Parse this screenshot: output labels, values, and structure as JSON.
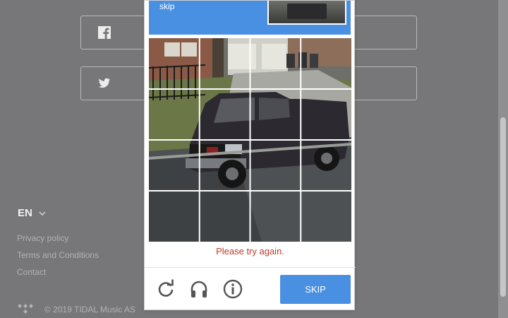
{
  "background": {
    "social": [
      {
        "name": "facebook",
        "icon": "facebook-icon"
      },
      {
        "name": "twitter",
        "icon": "twitter-icon"
      }
    ],
    "language": "EN",
    "footer_links": [
      "Privacy policy",
      "Terms and Conditions",
      "Contact"
    ],
    "copyright": "© 2019 TIDAL Music AS"
  },
  "captcha": {
    "header_text": "skip",
    "error_text": "Please try again.",
    "skip_label": "SKIP",
    "tools": [
      "reload-icon",
      "audio-icon",
      "info-icon"
    ],
    "grid_size": [
      4,
      4
    ]
  },
  "colors": {
    "accent": "#4a90e2",
    "error": "#c0392b"
  }
}
